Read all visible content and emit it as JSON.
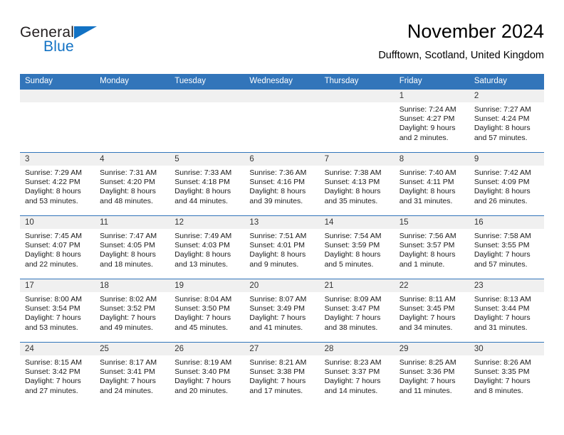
{
  "brand": {
    "name_part1": "General",
    "name_part2": "Blue",
    "logo_icon": "triangle-flag-icon"
  },
  "header": {
    "title": "November 2024",
    "location": "Dufftown, Scotland, United Kingdom"
  },
  "theme": {
    "header_blue": "#3275ba",
    "brand_blue": "#1272c4",
    "daynum_band": "#f0f0f0",
    "text": "#1a1a1a"
  },
  "calendar": {
    "weekday_headers": [
      "Sunday",
      "Monday",
      "Tuesday",
      "Wednesday",
      "Thursday",
      "Friday",
      "Saturday"
    ],
    "weeks": [
      [
        {
          "day": "",
          "lines": []
        },
        {
          "day": "",
          "lines": []
        },
        {
          "day": "",
          "lines": []
        },
        {
          "day": "",
          "lines": []
        },
        {
          "day": "",
          "lines": []
        },
        {
          "day": "1",
          "lines": [
            "Sunrise: 7:24 AM",
            "Sunset: 4:27 PM",
            "Daylight: 9 hours",
            "and 2 minutes."
          ]
        },
        {
          "day": "2",
          "lines": [
            "Sunrise: 7:27 AM",
            "Sunset: 4:24 PM",
            "Daylight: 8 hours",
            "and 57 minutes."
          ]
        }
      ],
      [
        {
          "day": "3",
          "lines": [
            "Sunrise: 7:29 AM",
            "Sunset: 4:22 PM",
            "Daylight: 8 hours",
            "and 53 minutes."
          ]
        },
        {
          "day": "4",
          "lines": [
            "Sunrise: 7:31 AM",
            "Sunset: 4:20 PM",
            "Daylight: 8 hours",
            "and 48 minutes."
          ]
        },
        {
          "day": "5",
          "lines": [
            "Sunrise: 7:33 AM",
            "Sunset: 4:18 PM",
            "Daylight: 8 hours",
            "and 44 minutes."
          ]
        },
        {
          "day": "6",
          "lines": [
            "Sunrise: 7:36 AM",
            "Sunset: 4:16 PM",
            "Daylight: 8 hours",
            "and 39 minutes."
          ]
        },
        {
          "day": "7",
          "lines": [
            "Sunrise: 7:38 AM",
            "Sunset: 4:13 PM",
            "Daylight: 8 hours",
            "and 35 minutes."
          ]
        },
        {
          "day": "8",
          "lines": [
            "Sunrise: 7:40 AM",
            "Sunset: 4:11 PM",
            "Daylight: 8 hours",
            "and 31 minutes."
          ]
        },
        {
          "day": "9",
          "lines": [
            "Sunrise: 7:42 AM",
            "Sunset: 4:09 PM",
            "Daylight: 8 hours",
            "and 26 minutes."
          ]
        }
      ],
      [
        {
          "day": "10",
          "lines": [
            "Sunrise: 7:45 AM",
            "Sunset: 4:07 PM",
            "Daylight: 8 hours",
            "and 22 minutes."
          ]
        },
        {
          "day": "11",
          "lines": [
            "Sunrise: 7:47 AM",
            "Sunset: 4:05 PM",
            "Daylight: 8 hours",
            "and 18 minutes."
          ]
        },
        {
          "day": "12",
          "lines": [
            "Sunrise: 7:49 AM",
            "Sunset: 4:03 PM",
            "Daylight: 8 hours",
            "and 13 minutes."
          ]
        },
        {
          "day": "13",
          "lines": [
            "Sunrise: 7:51 AM",
            "Sunset: 4:01 PM",
            "Daylight: 8 hours",
            "and 9 minutes."
          ]
        },
        {
          "day": "14",
          "lines": [
            "Sunrise: 7:54 AM",
            "Sunset: 3:59 PM",
            "Daylight: 8 hours",
            "and 5 minutes."
          ]
        },
        {
          "day": "15",
          "lines": [
            "Sunrise: 7:56 AM",
            "Sunset: 3:57 PM",
            "Daylight: 8 hours",
            "and 1 minute."
          ]
        },
        {
          "day": "16",
          "lines": [
            "Sunrise: 7:58 AM",
            "Sunset: 3:55 PM",
            "Daylight: 7 hours",
            "and 57 minutes."
          ]
        }
      ],
      [
        {
          "day": "17",
          "lines": [
            "Sunrise: 8:00 AM",
            "Sunset: 3:54 PM",
            "Daylight: 7 hours",
            "and 53 minutes."
          ]
        },
        {
          "day": "18",
          "lines": [
            "Sunrise: 8:02 AM",
            "Sunset: 3:52 PM",
            "Daylight: 7 hours",
            "and 49 minutes."
          ]
        },
        {
          "day": "19",
          "lines": [
            "Sunrise: 8:04 AM",
            "Sunset: 3:50 PM",
            "Daylight: 7 hours",
            "and 45 minutes."
          ]
        },
        {
          "day": "20",
          "lines": [
            "Sunrise: 8:07 AM",
            "Sunset: 3:49 PM",
            "Daylight: 7 hours",
            "and 41 minutes."
          ]
        },
        {
          "day": "21",
          "lines": [
            "Sunrise: 8:09 AM",
            "Sunset: 3:47 PM",
            "Daylight: 7 hours",
            "and 38 minutes."
          ]
        },
        {
          "day": "22",
          "lines": [
            "Sunrise: 8:11 AM",
            "Sunset: 3:45 PM",
            "Daylight: 7 hours",
            "and 34 minutes."
          ]
        },
        {
          "day": "23",
          "lines": [
            "Sunrise: 8:13 AM",
            "Sunset: 3:44 PM",
            "Daylight: 7 hours",
            "and 31 minutes."
          ]
        }
      ],
      [
        {
          "day": "24",
          "lines": [
            "Sunrise: 8:15 AM",
            "Sunset: 3:42 PM",
            "Daylight: 7 hours",
            "and 27 minutes."
          ]
        },
        {
          "day": "25",
          "lines": [
            "Sunrise: 8:17 AM",
            "Sunset: 3:41 PM",
            "Daylight: 7 hours",
            "and 24 minutes."
          ]
        },
        {
          "day": "26",
          "lines": [
            "Sunrise: 8:19 AM",
            "Sunset: 3:40 PM",
            "Daylight: 7 hours",
            "and 20 minutes."
          ]
        },
        {
          "day": "27",
          "lines": [
            "Sunrise: 8:21 AM",
            "Sunset: 3:38 PM",
            "Daylight: 7 hours",
            "and 17 minutes."
          ]
        },
        {
          "day": "28",
          "lines": [
            "Sunrise: 8:23 AM",
            "Sunset: 3:37 PM",
            "Daylight: 7 hours",
            "and 14 minutes."
          ]
        },
        {
          "day": "29",
          "lines": [
            "Sunrise: 8:25 AM",
            "Sunset: 3:36 PM",
            "Daylight: 7 hours",
            "and 11 minutes."
          ]
        },
        {
          "day": "30",
          "lines": [
            "Sunrise: 8:26 AM",
            "Sunset: 3:35 PM",
            "Daylight: 7 hours",
            "and 8 minutes."
          ]
        }
      ]
    ]
  }
}
